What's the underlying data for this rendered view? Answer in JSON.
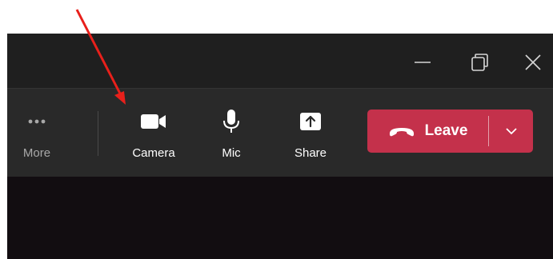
{
  "toolbar": {
    "more_label": "More",
    "camera_label": "Camera",
    "mic_label": "Mic",
    "share_label": "Share",
    "leave_label": "Leave"
  },
  "icons": {
    "more": "more-dots-icon",
    "camera": "video-camera-icon",
    "mic": "microphone-icon",
    "share": "share-screen-icon",
    "leave": "hang-up-phone-icon",
    "dropdown": "chevron-down-icon",
    "minimize": "minimize-icon",
    "restore": "restore-icon",
    "close": "close-icon",
    "annotation": "red-arrow-icon"
  },
  "colors": {
    "titlebar": "#1f1f1f",
    "toolbar": "#292929",
    "leave": "#c4314b",
    "video": "#120d11",
    "annotation_arrow": "#e8201b"
  }
}
